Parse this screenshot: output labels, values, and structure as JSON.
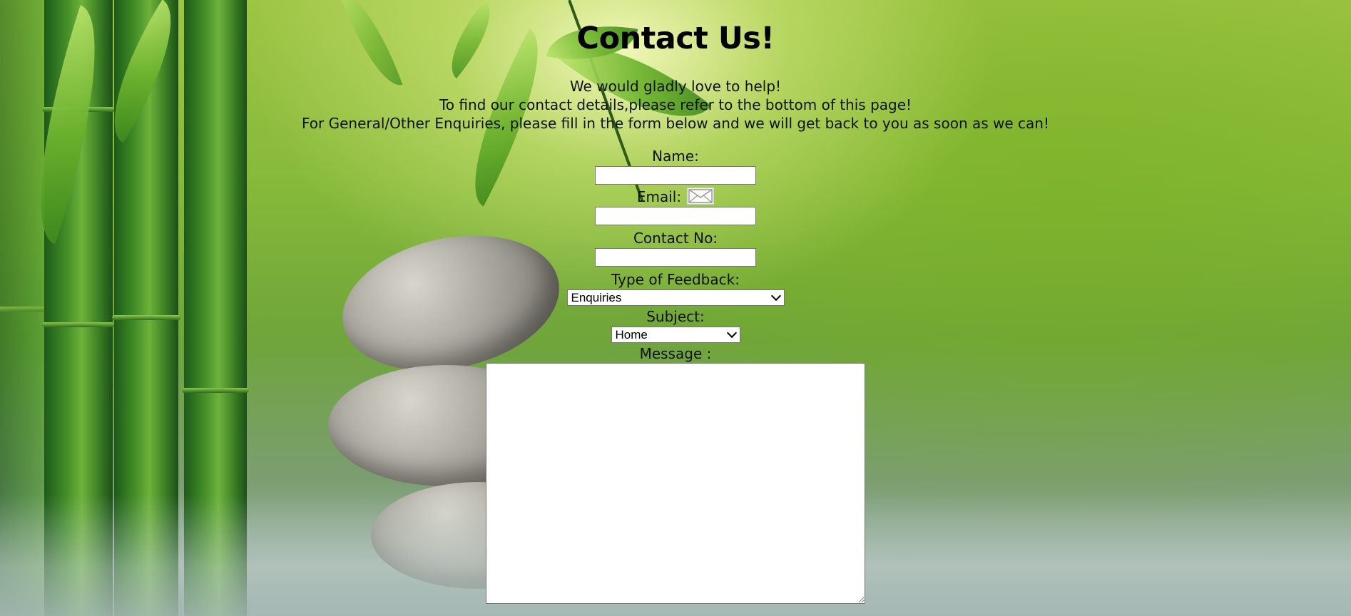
{
  "page": {
    "title": "Contact Us!",
    "intro_lines": [
      "We would gladly love to help!",
      "To find our contact details,please refer to the bottom of this page!",
      "For General/Other Enquiries, please fill in the form below and we will get back to you as soon as we can!"
    ]
  },
  "form": {
    "name_label": "Name:",
    "name_value": "",
    "email_label": "Email:",
    "email_value": "",
    "email_icon": "envelope-icon",
    "contact_label": "Contact No:",
    "contact_value": "",
    "feedback_label": "Type of Feedback:",
    "feedback_selected": "Enquiries",
    "subject_label": "Subject:",
    "subject_selected": "Home",
    "message_label": "Message :",
    "message_value": ""
  },
  "colors": {
    "background_green": "#86b93a",
    "text": "#111111",
    "field_border": "#767676"
  }
}
